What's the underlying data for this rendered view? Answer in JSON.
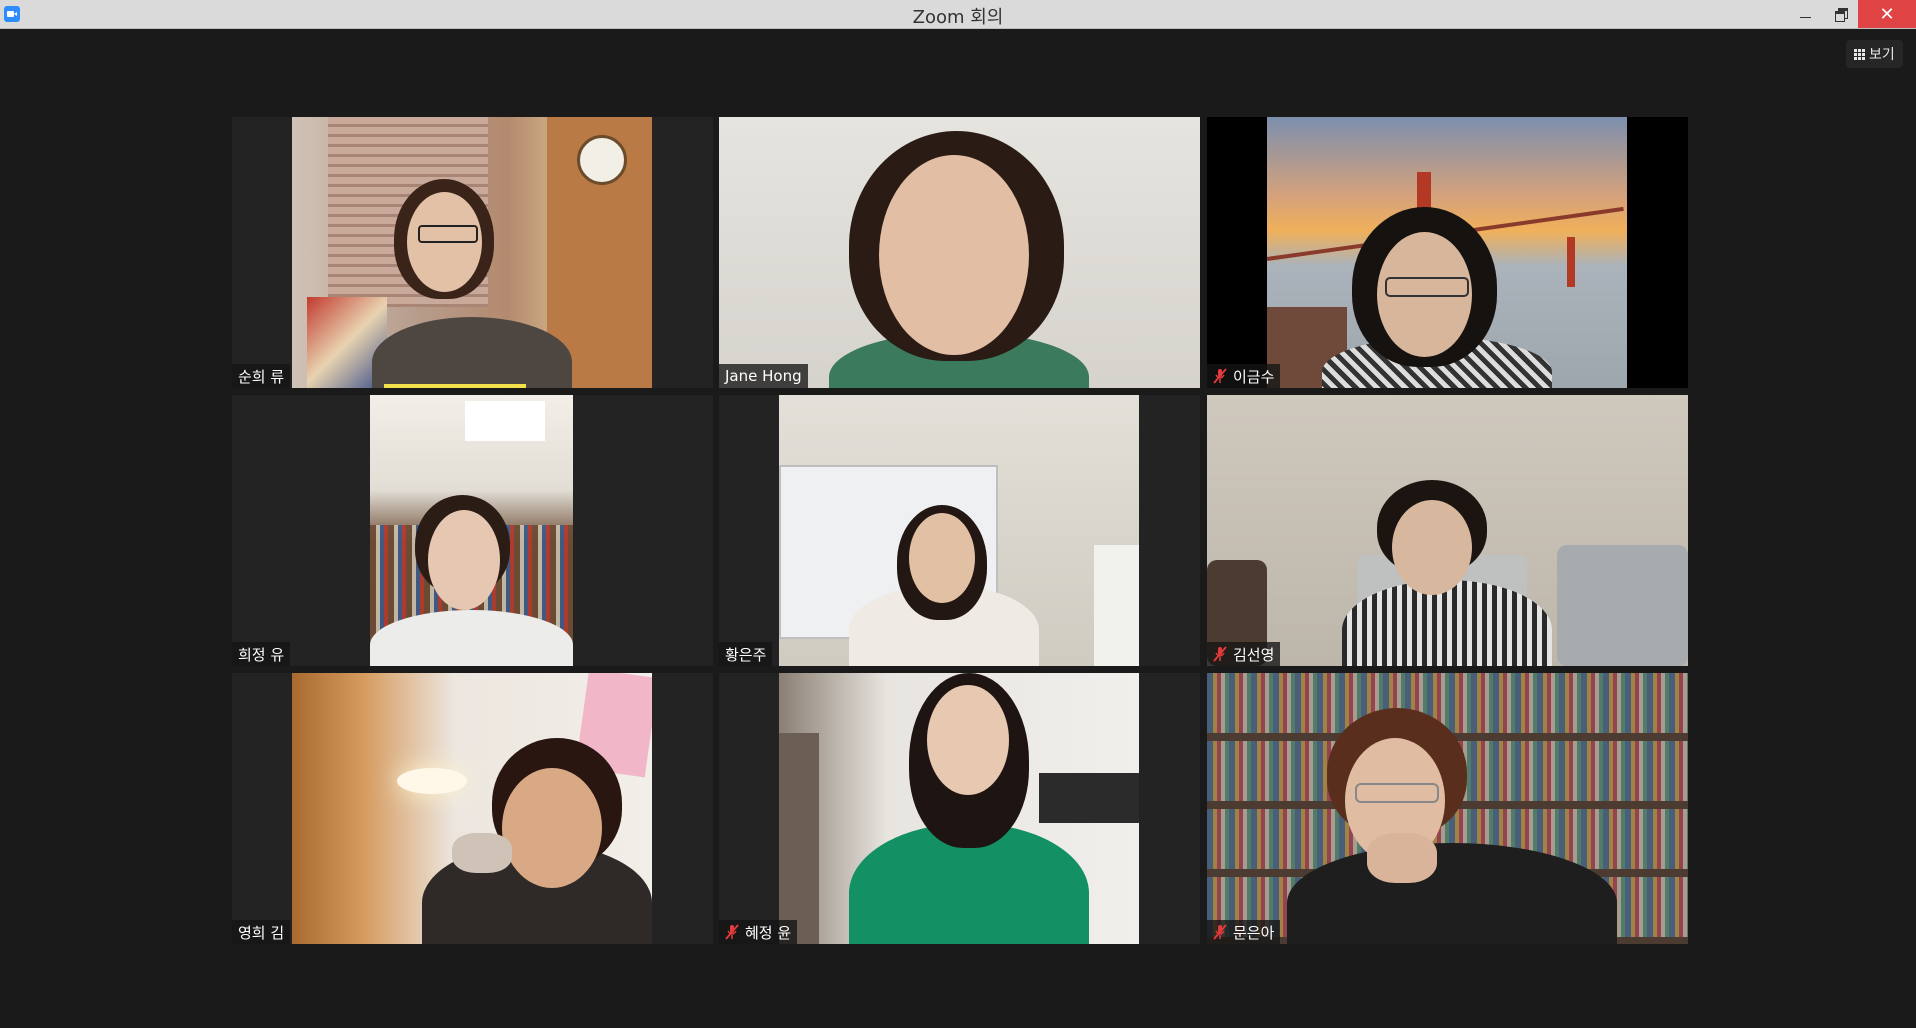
{
  "window": {
    "title": "Zoom 회의"
  },
  "toolbar": {
    "view_label": "보기"
  },
  "participants": [
    {
      "name": "순희 류",
      "muted": false,
      "active_speaker": true
    },
    {
      "name": "Jane Hong",
      "muted": false,
      "active_speaker": false
    },
    {
      "name": "이금수",
      "muted": true,
      "active_speaker": false
    },
    {
      "name": "희정 유",
      "muted": false,
      "active_speaker": false
    },
    {
      "name": "황은주",
      "muted": false,
      "active_speaker": false
    },
    {
      "name": "김선영",
      "muted": true,
      "active_speaker": false
    },
    {
      "name": "영희 김",
      "muted": false,
      "active_speaker": false
    },
    {
      "name": "혜정 윤",
      "muted": true,
      "active_speaker": false
    },
    {
      "name": "문은아",
      "muted": true,
      "active_speaker": false
    }
  ],
  "colors": {
    "background": "#1a1a1a",
    "titlebar": "#dadada",
    "close_button": "#e04343",
    "speaker_highlight": "#f2e14a",
    "mute_icon": "#e63b3b"
  }
}
